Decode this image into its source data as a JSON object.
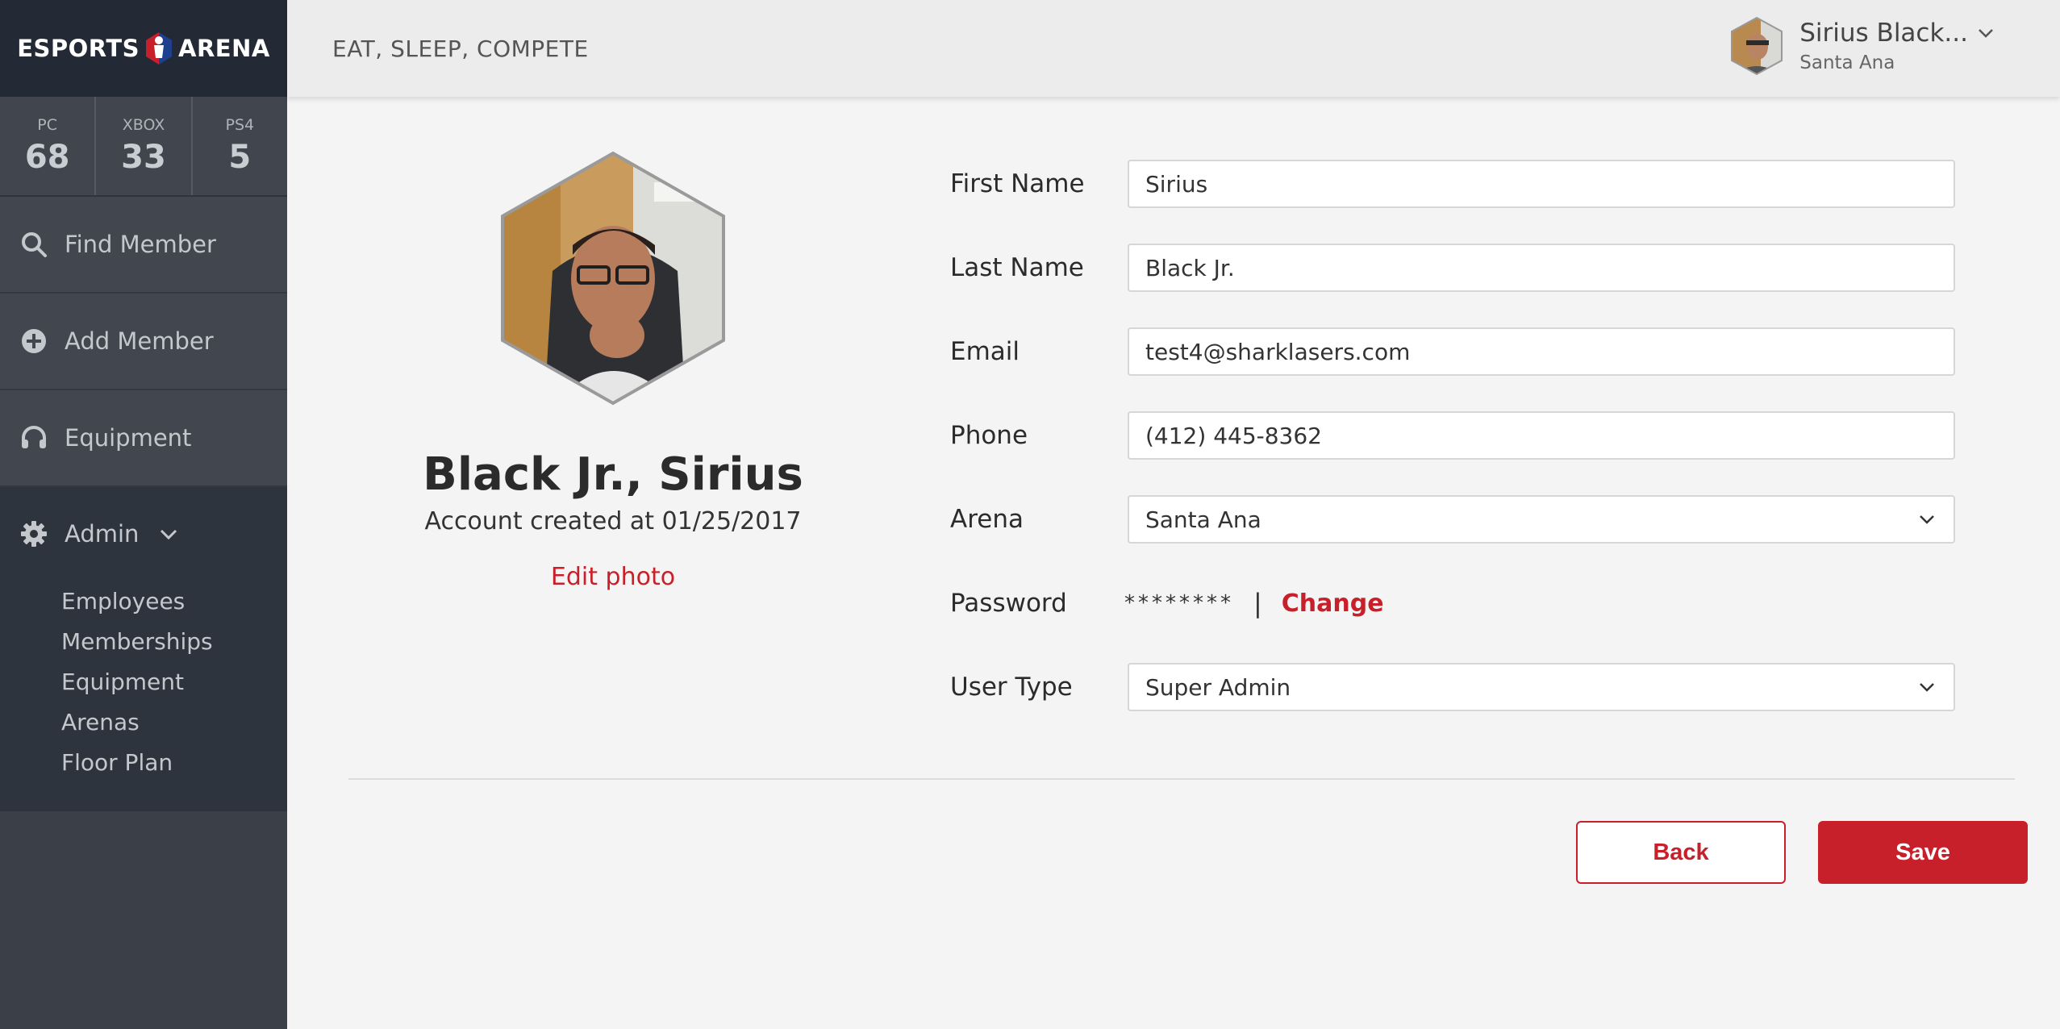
{
  "brand": {
    "left": "ESPORTS",
    "right": "ARENA"
  },
  "stats": [
    {
      "label": "PC",
      "value": "68"
    },
    {
      "label": "XBOX",
      "value": "33"
    },
    {
      "label": "PS4",
      "value": "5"
    }
  ],
  "nav": {
    "find_member": "Find Member",
    "add_member": "Add Member",
    "equipment": "Equipment",
    "admin": "Admin",
    "admin_items": [
      "Employees",
      "Memberships",
      "Equipment",
      "Arenas",
      "Floor Plan"
    ]
  },
  "header": {
    "tagline": "EAT, SLEEP, COMPETE",
    "user_name": "Sirius Black...",
    "user_location": "Santa Ana"
  },
  "profile": {
    "name": "Black Jr., Sirius",
    "created": "Account created at 01/25/2017",
    "edit_photo": "Edit photo"
  },
  "form": {
    "first_name_label": "First Name",
    "first_name": "Sirius",
    "last_name_label": "Last Name",
    "last_name": "Black Jr.",
    "email_label": "Email",
    "email": "test4@sharklasers.com",
    "phone_label": "Phone",
    "phone": "(412) 445-8362",
    "arena_label": "Arena",
    "arena": "Santa Ana",
    "password_label": "Password",
    "password_mask": "********",
    "password_sep": "|",
    "password_change": "Change",
    "user_type_label": "User Type",
    "user_type": "Super Admin"
  },
  "actions": {
    "back": "Back",
    "save": "Save"
  },
  "colors": {
    "accent": "#c8202a",
    "sidebar": "#3b4048",
    "sidebar_dark": "#232a35"
  }
}
